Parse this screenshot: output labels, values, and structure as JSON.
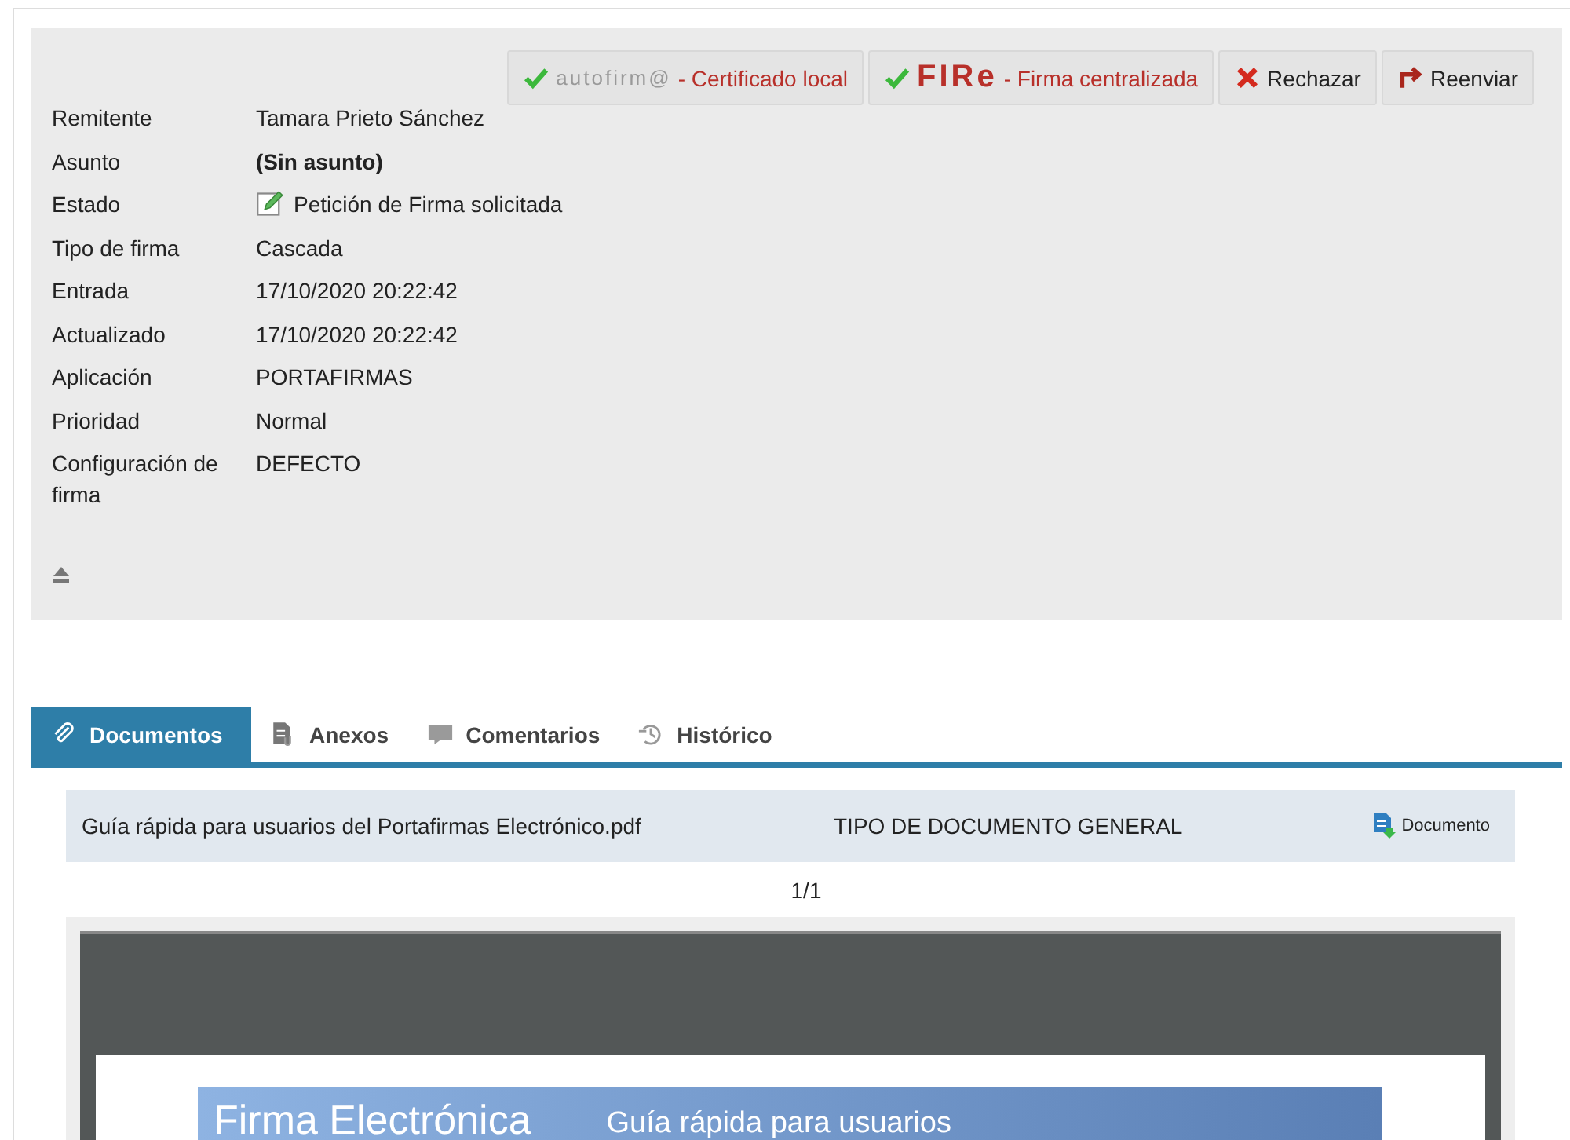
{
  "actions": [
    {
      "kind": "autofirma",
      "logo": "autofirm@",
      "label": "- Certificado local"
    },
    {
      "kind": "fire",
      "logo": "FIRe",
      "label": "- Firma centralizada"
    },
    {
      "kind": "reject",
      "label": "Rechazar"
    },
    {
      "kind": "forward",
      "label": "Reenviar"
    }
  ],
  "details": [
    {
      "label": "Remitente",
      "value": "Tamara Prieto Sánchez",
      "kind": "text"
    },
    {
      "label": "Asunto",
      "value": "(Sin asunto)",
      "kind": "bold"
    },
    {
      "label": "Estado",
      "value": "Petición de Firma solicitada",
      "kind": "status"
    },
    {
      "label": "Tipo de firma",
      "value": "Cascada",
      "kind": "text"
    },
    {
      "label": "Entrada",
      "value": "17/10/2020 20:22:42",
      "kind": "text"
    },
    {
      "label": "Actualizado",
      "value": "17/10/2020 20:22:42",
      "kind": "text"
    },
    {
      "label": "Aplicación",
      "value": "PORTAFIRMAS",
      "kind": "text"
    },
    {
      "label": "Prioridad",
      "value": "Normal",
      "kind": "text"
    },
    {
      "label": "Configuración de firma",
      "value": "DEFECTO",
      "kind": "text"
    }
  ],
  "tabs": [
    {
      "label": "Documentos",
      "kind": "clip",
      "selected": true
    },
    {
      "label": "Anexos",
      "kind": "attach",
      "selected": false
    },
    {
      "label": "Comentarios",
      "kind": "comment",
      "selected": false
    },
    {
      "label": "Histórico",
      "kind": "history",
      "selected": false
    }
  ],
  "document": {
    "name": "Guía rápida para usuarios del Portafirmas Electrónico.pdf",
    "type": "TIPO DE DOCUMENTO GENERAL",
    "button": "Documento"
  },
  "page_counter": "1/1",
  "preview": {
    "title": "Firma Electrónica",
    "subtitle": "Guía rápida para usuarios"
  }
}
